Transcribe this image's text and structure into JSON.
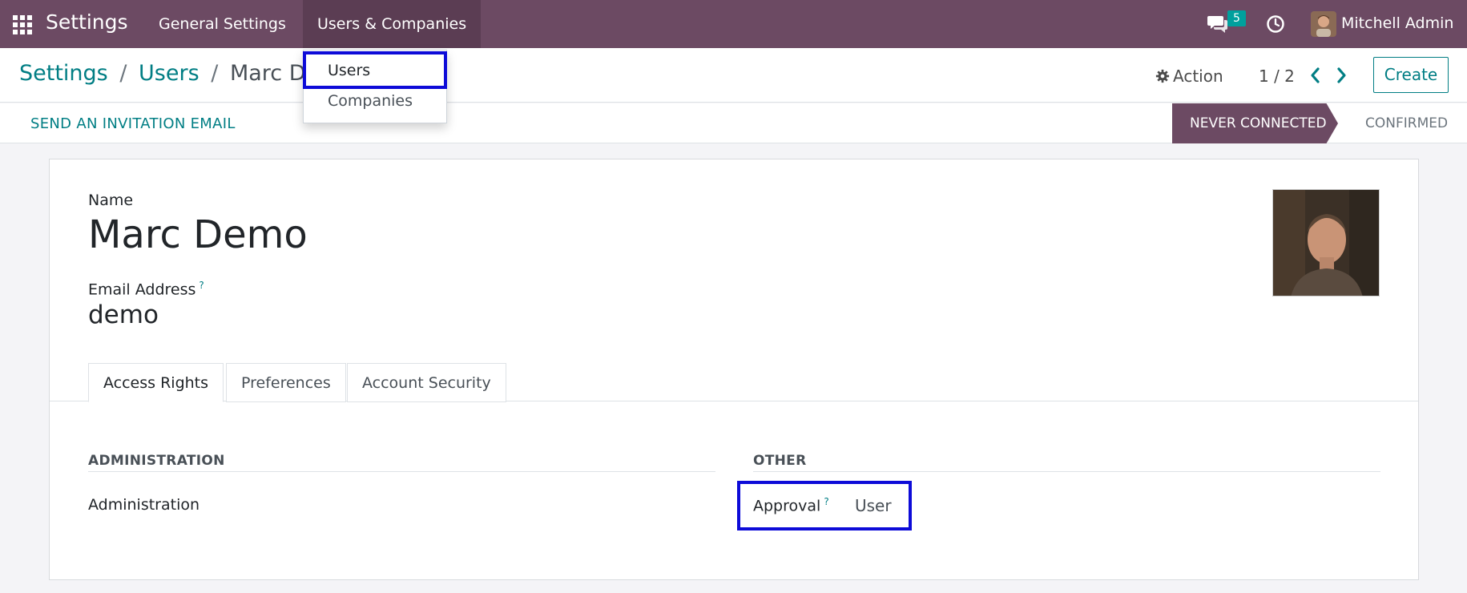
{
  "navbar": {
    "brand": "Settings",
    "menus": [
      "General Settings",
      "Users & Companies"
    ],
    "message_count": "5",
    "user_name": "Mitchell Admin"
  },
  "breadcrumb": {
    "items": [
      "Settings",
      "Users",
      "Marc Demo"
    ],
    "separator": "/",
    "visible_current": "Marc De"
  },
  "control": {
    "action_label": "Action",
    "pager": "1 / 2",
    "create_label": "Create"
  },
  "statusbar": {
    "invite_label": "SEND AN INVITATION EMAIL",
    "stages": [
      "NEVER CONNECTED",
      "CONFIRMED"
    ],
    "active_stage": "NEVER CONNECTED"
  },
  "form": {
    "name_label": "Name",
    "name_value": "Marc Demo",
    "email_label": "Email Address",
    "email_value": "demo",
    "help_mark": "?"
  },
  "tabs": [
    "Access Rights",
    "Preferences",
    "Account Security"
  ],
  "access_rights": {
    "sections": [
      "ADMINISTRATION",
      "OTHER"
    ],
    "administration_label": "Administration",
    "approval_label": "Approval",
    "approval_value": "User"
  },
  "dropdown": {
    "items": [
      "Users",
      "Companies"
    ]
  },
  "colors": {
    "navbar": "#6c4a63",
    "accent": "#017e84",
    "highlight": "#0d0bd8"
  }
}
